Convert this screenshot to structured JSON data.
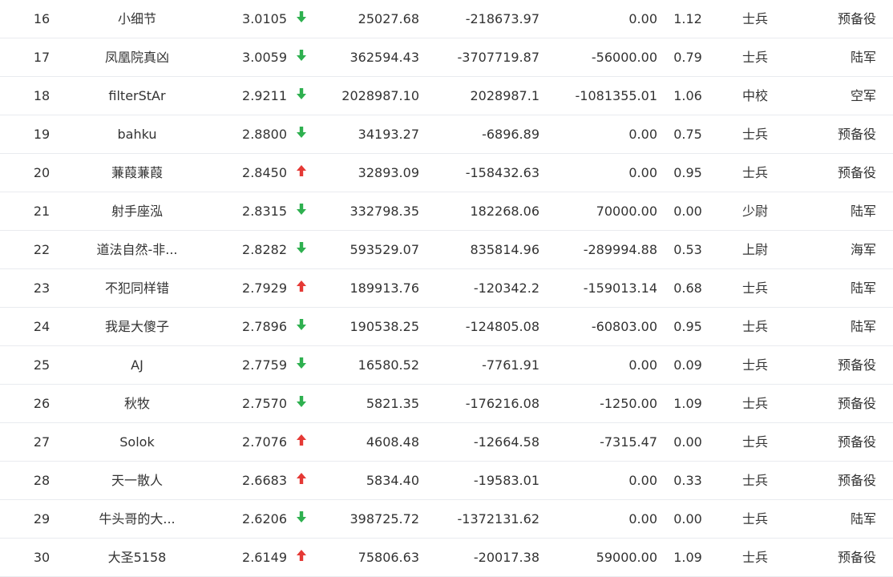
{
  "colors": {
    "up": "#e53935",
    "down": "#2eb04f",
    "text": "#333333",
    "divider": "#e9ebef"
  },
  "rows": [
    {
      "rank": "16",
      "name": "小细节",
      "score": "3.0105",
      "trend": "down",
      "v1": "25027.68",
      "v2": "-218673.97",
      "v3": "0.00",
      "ratio": "1.12",
      "rank_name": "士兵",
      "branch": "预备役"
    },
    {
      "rank": "17",
      "name": "凤凰院真凶",
      "score": "3.0059",
      "trend": "down",
      "v1": "362594.43",
      "v2": "-3707719.87",
      "v3": "-56000.00",
      "ratio": "0.79",
      "rank_name": "士兵",
      "branch": "陆军"
    },
    {
      "rank": "18",
      "name": "filterStAr",
      "score": "2.9211",
      "trend": "down",
      "v1": "2028987.10",
      "v2": "2028987.1",
      "v3": "-1081355.01",
      "ratio": "1.06",
      "rank_name": "中校",
      "branch": "空军"
    },
    {
      "rank": "19",
      "name": "bahku",
      "score": "2.8800",
      "trend": "down",
      "v1": "34193.27",
      "v2": "-6896.89",
      "v3": "0.00",
      "ratio": "0.75",
      "rank_name": "士兵",
      "branch": "预备役"
    },
    {
      "rank": "20",
      "name": "蒹葭蒹葭",
      "score": "2.8450",
      "trend": "up",
      "v1": "32893.09",
      "v2": "-158432.63",
      "v3": "0.00",
      "ratio": "0.95",
      "rank_name": "士兵",
      "branch": "预备役"
    },
    {
      "rank": "21",
      "name": "射手座泓",
      "score": "2.8315",
      "trend": "down",
      "v1": "332798.35",
      "v2": "182268.06",
      "v3": "70000.00",
      "ratio": "0.00",
      "rank_name": "少尉",
      "branch": "陆军"
    },
    {
      "rank": "22",
      "name": "道法自然-非...",
      "score": "2.8282",
      "trend": "down",
      "v1": "593529.07",
      "v2": "835814.96",
      "v3": "-289994.88",
      "ratio": "0.53",
      "rank_name": "上尉",
      "branch": "海军"
    },
    {
      "rank": "23",
      "name": "不犯同样错",
      "score": "2.7929",
      "trend": "up",
      "v1": "189913.76",
      "v2": "-120342.2",
      "v3": "-159013.14",
      "ratio": "0.68",
      "rank_name": "士兵",
      "branch": "陆军"
    },
    {
      "rank": "24",
      "name": "我是大傻子",
      "score": "2.7896",
      "trend": "down",
      "v1": "190538.25",
      "v2": "-124805.08",
      "v3": "-60803.00",
      "ratio": "0.95",
      "rank_name": "士兵",
      "branch": "陆军"
    },
    {
      "rank": "25",
      "name": "AJ",
      "score": "2.7759",
      "trend": "down",
      "v1": "16580.52",
      "v2": "-7761.91",
      "v3": "0.00",
      "ratio": "0.09",
      "rank_name": "士兵",
      "branch": "预备役"
    },
    {
      "rank": "26",
      "name": "秋牧",
      "score": "2.7570",
      "trend": "down",
      "v1": "5821.35",
      "v2": "-176216.08",
      "v3": "-1250.00",
      "ratio": "1.09",
      "rank_name": "士兵",
      "branch": "预备役"
    },
    {
      "rank": "27",
      "name": "Solok",
      "score": "2.7076",
      "trend": "up",
      "v1": "4608.48",
      "v2": "-12664.58",
      "v3": "-7315.47",
      "ratio": "0.00",
      "rank_name": "士兵",
      "branch": "预备役"
    },
    {
      "rank": "28",
      "name": "天一散人",
      "score": "2.6683",
      "trend": "up",
      "v1": "5834.40",
      "v2": "-19583.01",
      "v3": "0.00",
      "ratio": "0.33",
      "rank_name": "士兵",
      "branch": "预备役"
    },
    {
      "rank": "29",
      "name": "牛头哥的大...",
      "score": "2.6206",
      "trend": "down",
      "v1": "398725.72",
      "v2": "-1372131.62",
      "v3": "0.00",
      "ratio": "0.00",
      "rank_name": "士兵",
      "branch": "陆军"
    },
    {
      "rank": "30",
      "name": "大圣5158",
      "score": "2.6149",
      "trend": "up",
      "v1": "75806.63",
      "v2": "-20017.38",
      "v3": "59000.00",
      "ratio": "1.09",
      "rank_name": "士兵",
      "branch": "预备役"
    }
  ]
}
